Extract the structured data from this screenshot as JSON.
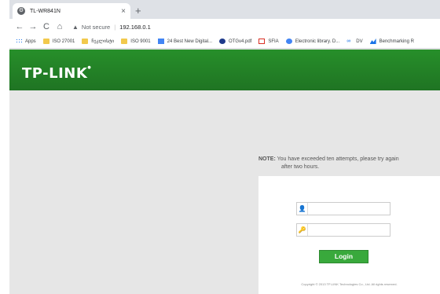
{
  "browser": {
    "tab": {
      "title": "TL-WR841N",
      "close": "×"
    },
    "new_tab": "+",
    "nav": {
      "back": "←",
      "forward": "→",
      "reload": "C",
      "home": "⌂"
    },
    "address": {
      "security_label": "Not secure",
      "url": "192.168.0.1"
    },
    "bookmarks": [
      {
        "icon": "apps-icon",
        "label": "Apps"
      },
      {
        "icon": "folder-icon",
        "label": "ISO 27001"
      },
      {
        "icon": "folder-icon",
        "label": "ჩეკლისტი"
      },
      {
        "icon": "folder-icon",
        "label": "ISO 9001"
      },
      {
        "icon": "document-icon",
        "label": "24 Best New Digital..."
      },
      {
        "icon": "globe-icon",
        "label": "OTGv4.pdf"
      },
      {
        "icon": "pdf-icon",
        "label": "SFIA"
      },
      {
        "icon": "cloud-icon",
        "label": "Electronic library. D..."
      },
      {
        "icon": "dv-icon",
        "label": "DV"
      },
      {
        "icon": "chart-icon",
        "label": "Benchmarking R"
      }
    ]
  },
  "router": {
    "brand": "TP-LINK",
    "note": {
      "label": "NOTE:",
      "line1": "You have exceeded ten attempts, please try again",
      "line2": "after two hours."
    },
    "login": {
      "username_placeholder": "",
      "password_placeholder": "",
      "button_label": "Login",
      "copyright": "Copyright © 2013 TP-LINK Technologies Co., Ltd. All rights reserved."
    },
    "colors": {
      "header_green": "#278f2a",
      "button_green": "#39a93c"
    }
  }
}
